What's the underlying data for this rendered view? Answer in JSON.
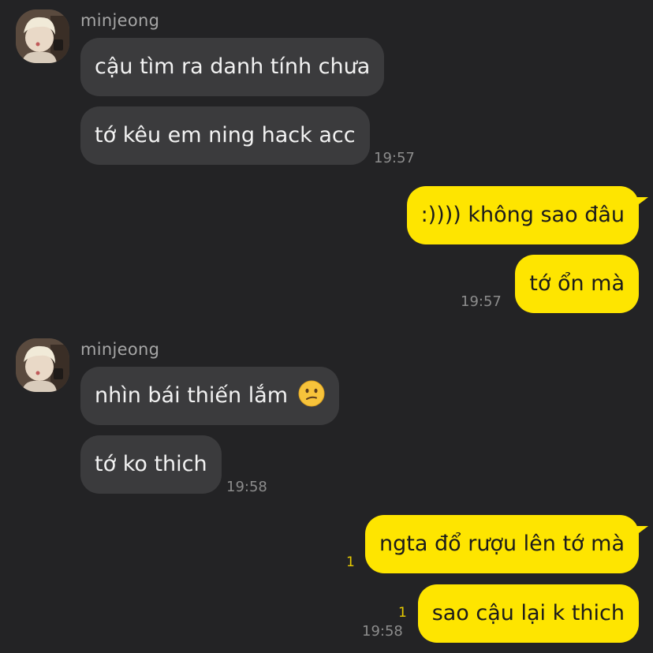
{
  "messages": {
    "g1": {
      "sender": "minjeong",
      "m1": "cậu tìm ra danh tính chưa",
      "m2": "tớ kêu em ning hack acc",
      "time": "19:57"
    },
    "g2": {
      "m1": ":)))) không sao đâu",
      "m2": "tớ ổn mà",
      "time": "19:57"
    },
    "g3": {
      "sender": "minjeong",
      "m1": "nhìn bái thiến lắm",
      "m1_emoji": "confused-face-emoji",
      "m2": "tớ ko thich",
      "time": "19:58"
    },
    "g4": {
      "m1": "ngta đổ rượu lên tớ mà",
      "m1_unread": "1",
      "m2": "sao cậu lại k thich",
      "m2_unread": "1",
      "time": "19:58"
    }
  },
  "colors": {
    "background": "#232325",
    "incoming_bubble": "#3b3b3d",
    "outgoing_bubble": "#fee500",
    "unread_count": "#e8cc00"
  }
}
